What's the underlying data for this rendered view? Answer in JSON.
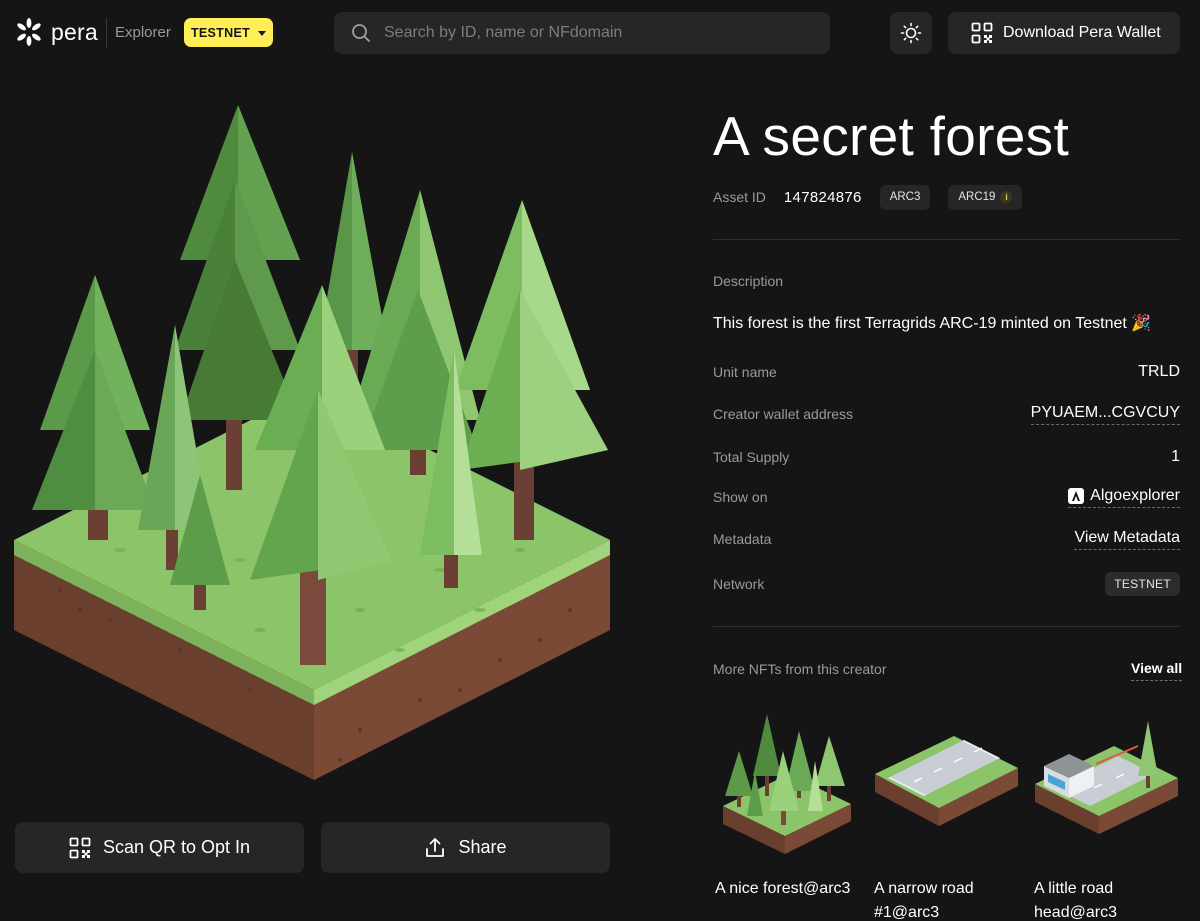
{
  "header": {
    "logo_text": "pera",
    "explorer_label": "Explorer",
    "network_badge": "TESTNET",
    "search_placeholder": "Search by ID, name or NFdomain",
    "download_label": "Download Pera Wallet"
  },
  "actions": {
    "scan_label": "Scan QR to Opt In",
    "share_label": "Share"
  },
  "asset": {
    "title": "A secret forest",
    "asset_id_label": "Asset ID",
    "asset_id": "147824876",
    "standards": [
      "ARC3",
      "ARC19"
    ],
    "info_glyph": "i",
    "description_label": "Description",
    "description": "This forest is the first Terragrids ARC-19 minted on Testnet 🎉"
  },
  "properties": [
    {
      "label": "Unit name",
      "value": "TRLD"
    },
    {
      "label": "Creator wallet address",
      "value": "PYUAEM...CGVCUY"
    },
    {
      "label": "Total Supply",
      "value": "1"
    },
    {
      "label": "Show on",
      "value": "Algoexplorer",
      "icon": "algoexplorer-icon"
    },
    {
      "label": "Metadata",
      "value": "View Metadata"
    },
    {
      "label": "Network",
      "value": "TESTNET"
    }
  ],
  "more_nfts": {
    "label": "More NFTs from this creator",
    "view_all": "View all",
    "items": [
      {
        "name": "A nice forest@arc3"
      },
      {
        "name": "A narrow road #1@arc3"
      },
      {
        "name": "A little road head@arc3"
      }
    ]
  },
  "colors": {
    "background": "#151515",
    "surface": "#262626",
    "accent_yellow": "#ffee55",
    "muted_text": "#9a9a9a"
  }
}
